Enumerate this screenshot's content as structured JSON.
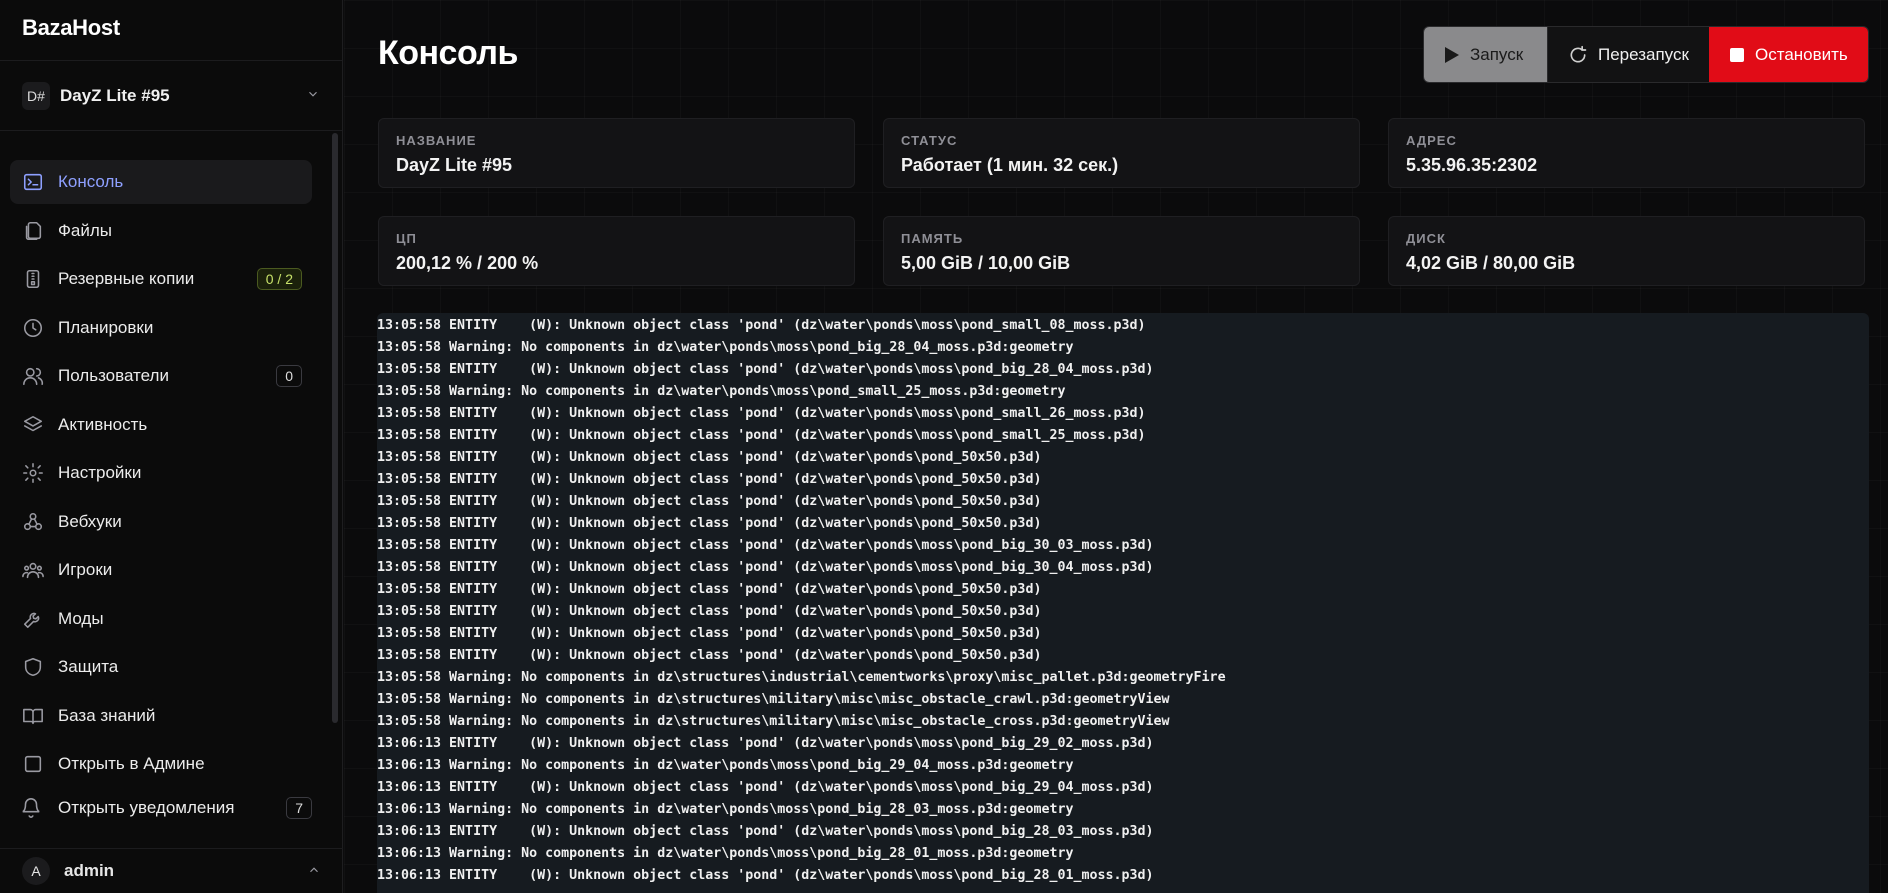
{
  "brand": "BazaHost",
  "server_switch": {
    "tag": "D#",
    "name": "DayZ Lite #95"
  },
  "sidebar": {
    "items": [
      {
        "label": "Консоль",
        "icon": "terminal-icon",
        "active": true,
        "badge": ""
      },
      {
        "label": "Файлы",
        "icon": "files-icon",
        "badge": ""
      },
      {
        "label": "Резервные копии",
        "icon": "archive-icon",
        "badge": "0 / 2"
      },
      {
        "label": "Планировки",
        "icon": "clock-icon",
        "badge": ""
      },
      {
        "label": "Пользователи",
        "icon": "users-icon",
        "badge": "0"
      },
      {
        "label": "Активность",
        "icon": "layers-icon",
        "badge": ""
      },
      {
        "label": "Настройки",
        "icon": "gear-icon",
        "badge": ""
      },
      {
        "label": "Вебхуки",
        "icon": "webhook-icon",
        "badge": ""
      },
      {
        "label": "Игроки",
        "icon": "players-icon",
        "badge": ""
      },
      {
        "label": "Моды",
        "icon": "wrench-icon",
        "badge": ""
      },
      {
        "label": "Защита",
        "icon": "shield-icon",
        "badge": ""
      },
      {
        "label": "База знаний",
        "icon": "book-icon",
        "badge": ""
      },
      {
        "label": "Открыть в Админе",
        "icon": "admin-icon",
        "badge": ""
      }
    ],
    "notifications": {
      "label": "Открыть уведомления",
      "count": "7"
    },
    "user": {
      "avatar": "A",
      "name": "admin"
    }
  },
  "main": {
    "title": "Консоль",
    "power": {
      "start": "Запуск",
      "restart": "Перезапуск",
      "stop": "Остановить"
    },
    "cards": [
      {
        "label": "НАЗВАНИЕ",
        "value": "DayZ Lite #95"
      },
      {
        "label": "СТАТУС",
        "value": "Работает (1 мин. 32 сек.)"
      },
      {
        "label": "АДРЕС",
        "value": "5.35.96.35:2302"
      },
      {
        "label": "ЦП",
        "value": "200,12 % / 200 %"
      },
      {
        "label": "ПАМЯТЬ",
        "value": "5,00 GiB / 10,00 GiB"
      },
      {
        "label": "ДИСК",
        "value": "4,02 GiB / 80,00 GiB"
      }
    ],
    "console_lines": [
      "13:05:58 ENTITY    (W): Unknown object class 'pond' (dz\\water\\ponds\\moss\\pond_small_08_moss.p3d)",
      "13:05:58 Warning: No components in dz\\water\\ponds\\moss\\pond_big_28_04_moss.p3d:geometry",
      "13:05:58 ENTITY    (W): Unknown object class 'pond' (dz\\water\\ponds\\moss\\pond_big_28_04_moss.p3d)",
      "13:05:58 Warning: No components in dz\\water\\ponds\\moss\\pond_small_25_moss.p3d:geometry",
      "13:05:58 ENTITY    (W): Unknown object class 'pond' (dz\\water\\ponds\\moss\\pond_small_26_moss.p3d)",
      "13:05:58 ENTITY    (W): Unknown object class 'pond' (dz\\water\\ponds\\moss\\pond_small_25_moss.p3d)",
      "13:05:58 ENTITY    (W): Unknown object class 'pond' (dz\\water\\ponds\\pond_50x50.p3d)",
      "13:05:58 ENTITY    (W): Unknown object class 'pond' (dz\\water\\ponds\\pond_50x50.p3d)",
      "13:05:58 ENTITY    (W): Unknown object class 'pond' (dz\\water\\ponds\\pond_50x50.p3d)",
      "13:05:58 ENTITY    (W): Unknown object class 'pond' (dz\\water\\ponds\\pond_50x50.p3d)",
      "13:05:58 ENTITY    (W): Unknown object class 'pond' (dz\\water\\ponds\\moss\\pond_big_30_03_moss.p3d)",
      "13:05:58 ENTITY    (W): Unknown object class 'pond' (dz\\water\\ponds\\moss\\pond_big_30_04_moss.p3d)",
      "13:05:58 ENTITY    (W): Unknown object class 'pond' (dz\\water\\ponds\\pond_50x50.p3d)",
      "13:05:58 ENTITY    (W): Unknown object class 'pond' (dz\\water\\ponds\\pond_50x50.p3d)",
      "13:05:58 ENTITY    (W): Unknown object class 'pond' (dz\\water\\ponds\\pond_50x50.p3d)",
      "13:05:58 ENTITY    (W): Unknown object class 'pond' (dz\\water\\ponds\\pond_50x50.p3d)",
      "13:05:58 Warning: No components in dz\\structures\\industrial\\cementworks\\proxy\\misc_pallet.p3d:geometryFire",
      "13:05:58 Warning: No components in dz\\structures\\military\\misc\\misc_obstacle_crawl.p3d:geometryView",
      "13:05:58 Warning: No components in dz\\structures\\military\\misc\\misc_obstacle_cross.p3d:geometryView",
      "13:06:13 ENTITY    (W): Unknown object class 'pond' (dz\\water\\ponds\\moss\\pond_big_29_02_moss.p3d)",
      "13:06:13 Warning: No components in dz\\water\\ponds\\moss\\pond_big_29_04_moss.p3d:geometry",
      "13:06:13 ENTITY    (W): Unknown object class 'pond' (dz\\water\\ponds\\moss\\pond_big_29_04_moss.p3d)",
      "13:06:13 Warning: No components in dz\\water\\ponds\\moss\\pond_big_28_03_moss.p3d:geometry",
      "13:06:13 ENTITY    (W): Unknown object class 'pond' (dz\\water\\ponds\\moss\\pond_big_28_03_moss.p3d)",
      "13:06:13 Warning: No components in dz\\water\\ponds\\moss\\pond_big_28_01_moss.p3d:geometry",
      "13:06:13 ENTITY    (W): Unknown object class 'pond' (dz\\water\\ponds\\moss\\pond_big_28_01_moss.p3d)"
    ]
  },
  "colors": {
    "accent": "#8ea0ff",
    "stop": "#e10c17",
    "badge_green": "#c8e26a",
    "console_bg": "#161b20"
  }
}
